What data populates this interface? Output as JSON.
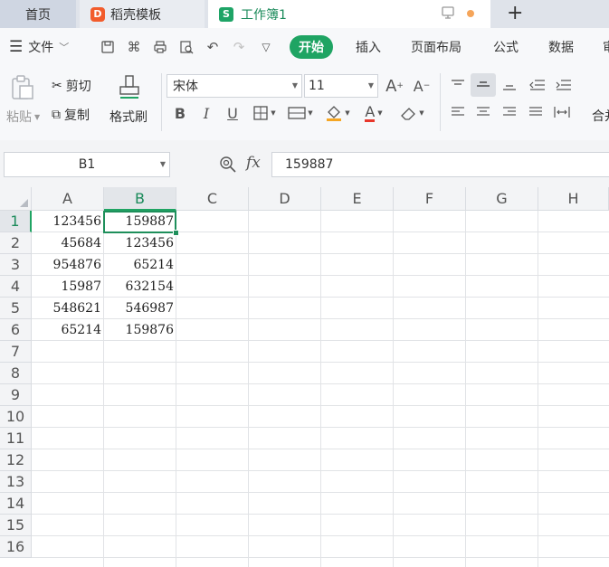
{
  "tabs": {
    "home": "首页",
    "templates": "稻壳模板",
    "document": "工作簿1"
  },
  "menu": {
    "file": "文件",
    "items": [
      "开始",
      "插入",
      "页面布局",
      "公式",
      "数据",
      "审"
    ]
  },
  "ribbon": {
    "paste": "粘贴",
    "cut": "剪切",
    "copy": "复制",
    "format_painter": "格式刷",
    "font_name": "宋体",
    "font_size": "11",
    "merge_label": "合并"
  },
  "formula_bar": {
    "name_box": "B1",
    "fx": "fx",
    "value": "159887"
  },
  "sheet": {
    "columns": [
      "A",
      "B",
      "C",
      "D",
      "E",
      "F",
      "G",
      "H"
    ],
    "rows": [
      "1",
      "2",
      "3",
      "4",
      "5",
      "6",
      "7",
      "8",
      "9",
      "10",
      "11",
      "12",
      "13",
      "14",
      "15",
      "16"
    ],
    "selected_cell": "B1",
    "data": [
      {
        "A": "123456",
        "B": "159887"
      },
      {
        "A": "45684",
        "B": "123456"
      },
      {
        "A": "954876",
        "B": "65214"
      },
      {
        "A": "15987",
        "B": "632154"
      },
      {
        "A": "548621",
        "B": "546987"
      },
      {
        "A": "65214",
        "B": "159876"
      }
    ]
  },
  "colors": {
    "accent": "#1fa463",
    "selection_border": "#1e8f5b"
  }
}
